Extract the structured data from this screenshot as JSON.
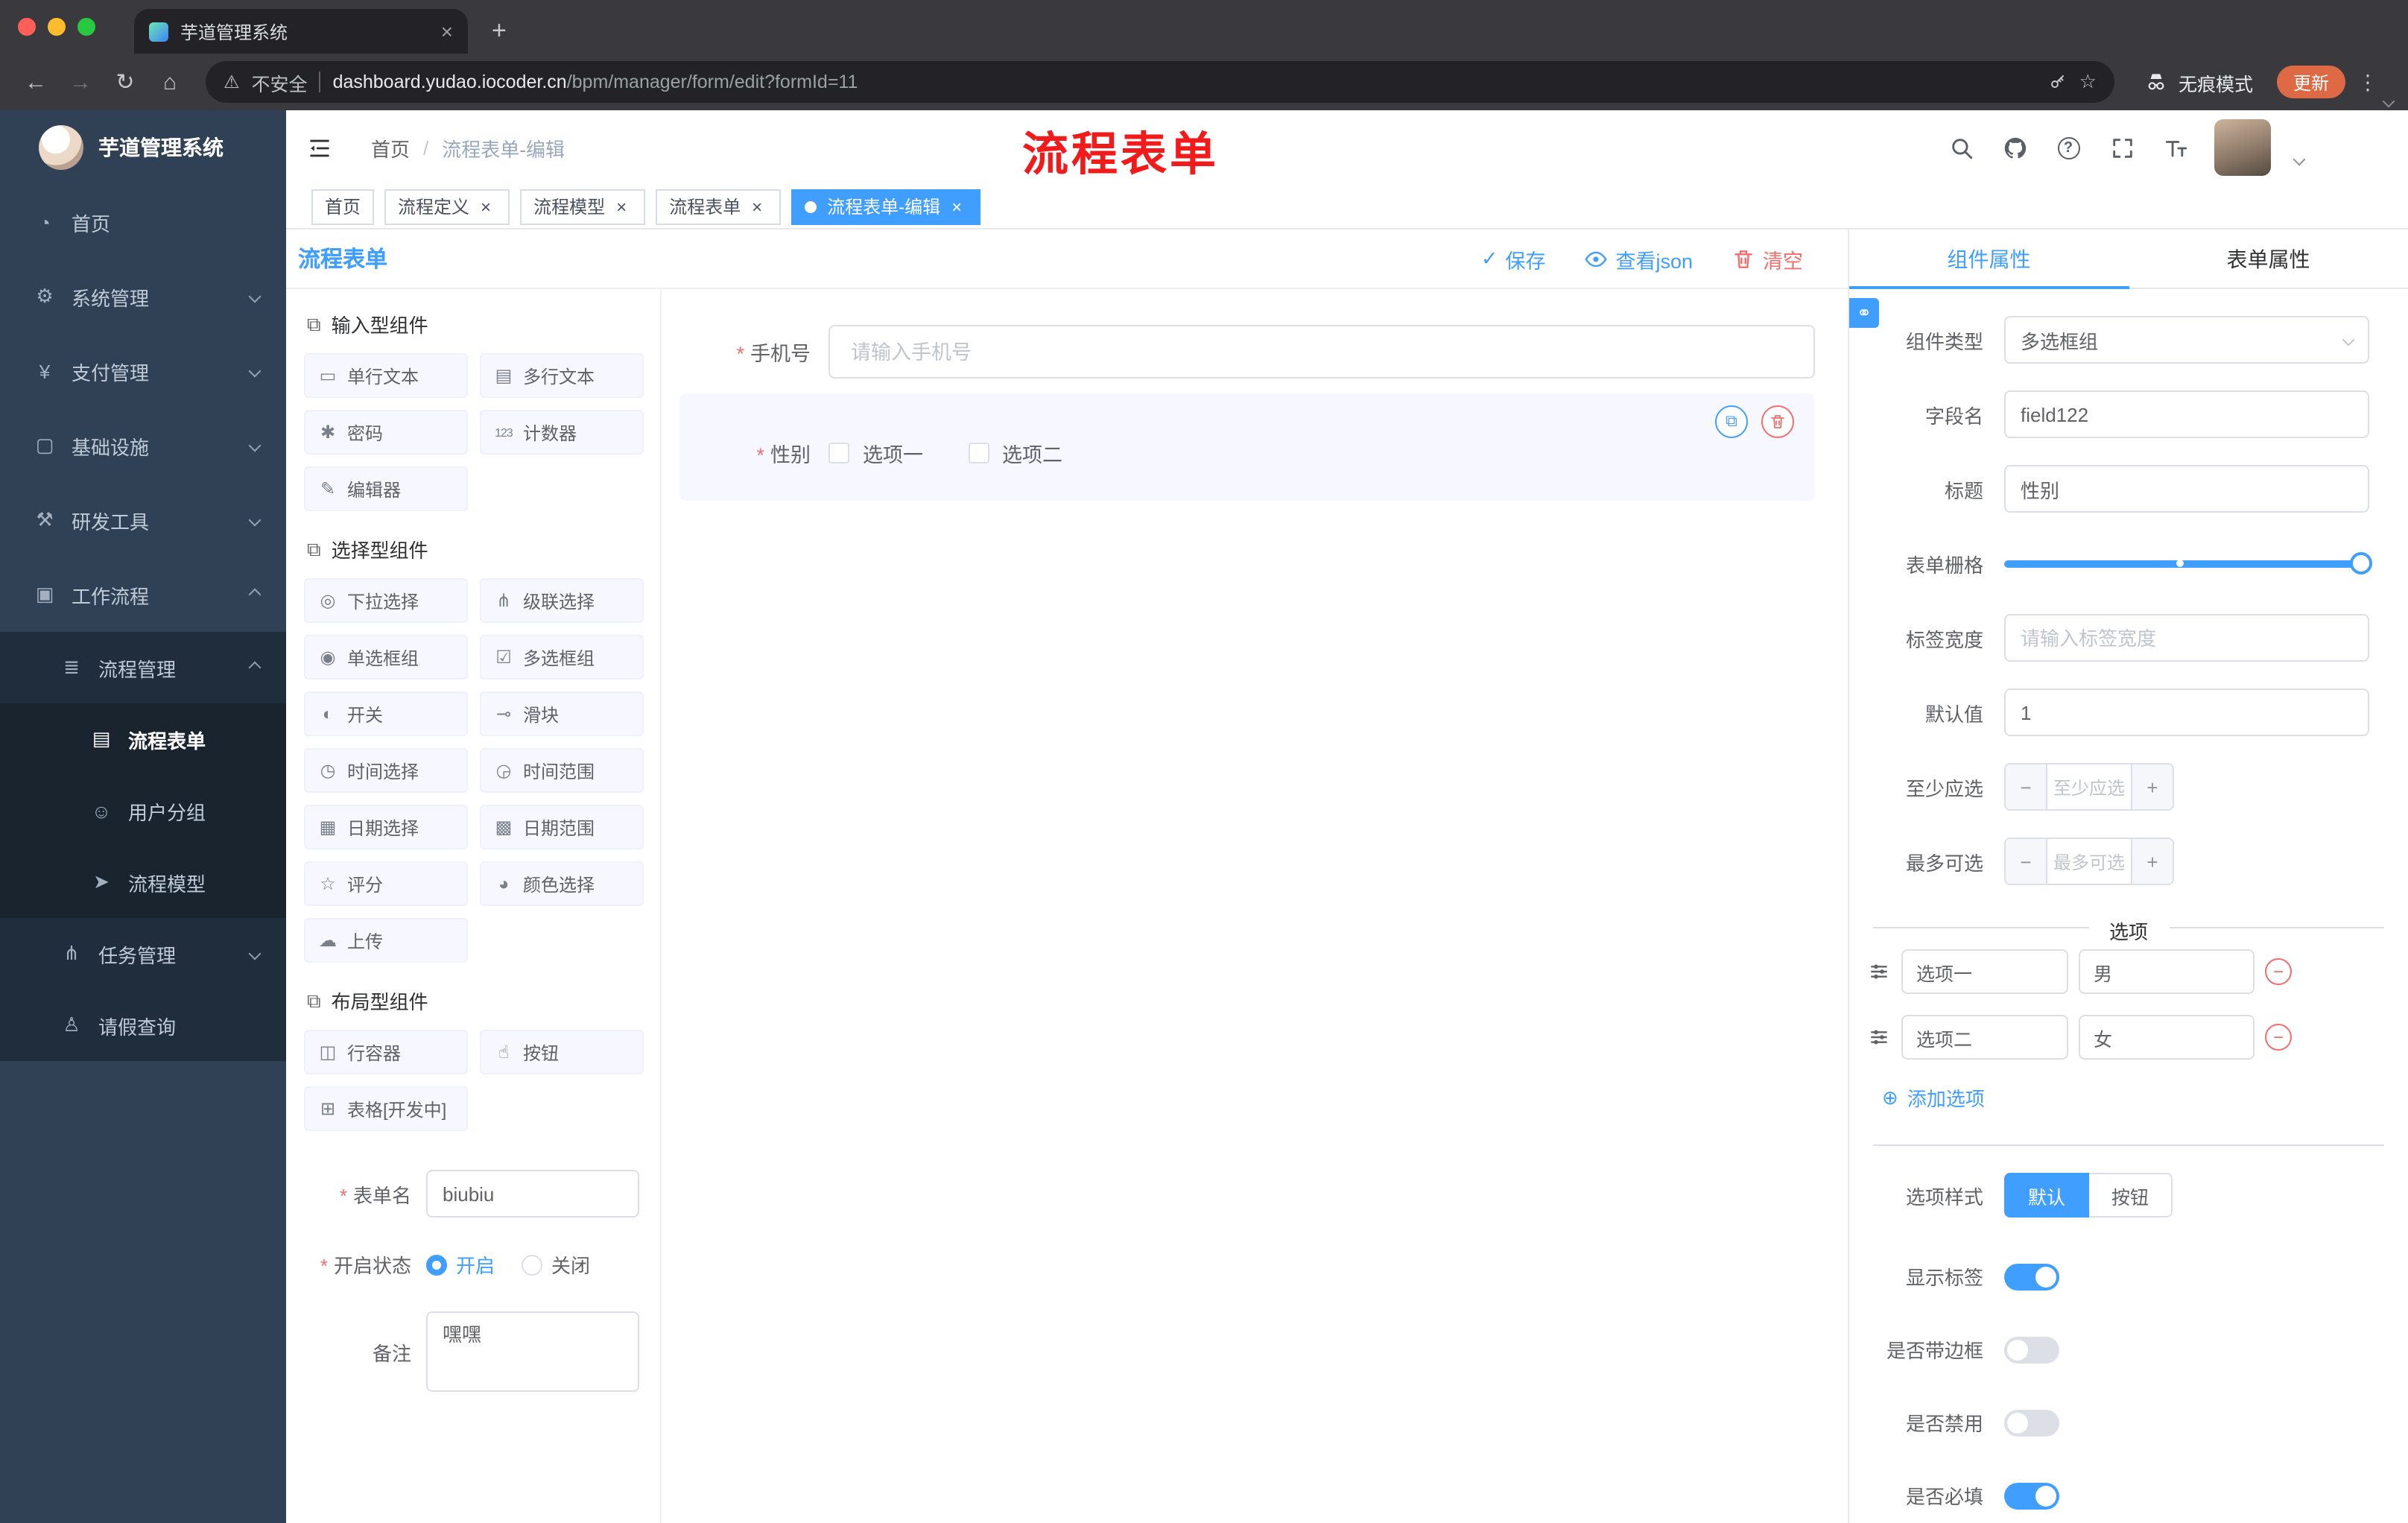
{
  "colors": {
    "primary": "#409eff",
    "danger": "#f56c6c",
    "annotation_red": "#f21b1b",
    "sidebar_bg": "#304156",
    "sidebar_submenu_bg": "#1f2d3d",
    "active_tag_bg": "#409eff"
  },
  "glyphs": {
    "close": "×",
    "plus": "+",
    "kebab": "⋮",
    "minus": "−",
    "check": "✓",
    "circle_plus": "⊕",
    "copy": "⧉",
    "link": "⚭",
    "warning": "⚠",
    "star": "☆",
    "back": "←",
    "forward": "→",
    "reload": "↻",
    "home": "⌂",
    "help": "?"
  },
  "browser": {
    "tab": {
      "title": "芋道管理系统"
    },
    "toolbar": {
      "security_label": "不安全",
      "url_host": "dashboard.yudao.iocoder.cn",
      "url_path": "/bpm/manager/form/edit?formId=11",
      "incognito_label": "无痕模式",
      "update_label": "更新"
    }
  },
  "navbar": {
    "breadcrumb": {
      "home": "首页",
      "separator": "/",
      "current": "流程表单-编辑"
    },
    "annotation": "流程表单"
  },
  "tags": [
    {
      "label": "首页"
    },
    {
      "label": "流程定义"
    },
    {
      "label": "流程模型"
    },
    {
      "label": "流程表单"
    },
    {
      "label": "流程表单-编辑"
    }
  ],
  "sidebar": {
    "logo_title": "芋道管理系统",
    "items": [
      {
        "label": "首页",
        "glyph": "◔"
      },
      {
        "label": "系统管理",
        "glyph": "⚙"
      },
      {
        "label": "支付管理",
        "glyph": "¥"
      },
      {
        "label": "基础设施",
        "glyph": "▢"
      },
      {
        "label": "研发工具",
        "glyph": "⚒"
      },
      {
        "label": "工作流程",
        "glyph": "▣"
      },
      {
        "label": "流程管理",
        "glyph": "≣"
      },
      {
        "label": "流程表单",
        "glyph": "▤"
      },
      {
        "label": "用户分组",
        "glyph": "☺"
      },
      {
        "label": "流程模型",
        "glyph": "➤"
      },
      {
        "label": "任务管理",
        "glyph": "⋔"
      },
      {
        "label": "请假查询",
        "glyph": "♙"
      }
    ]
  },
  "designer": {
    "title": "流程表单",
    "actions": {
      "save": "保存",
      "view_json": "查看json",
      "clear": "清空"
    },
    "groups": [
      {
        "title": "输入型组件",
        "items": [
          {
            "label": "单行文本",
            "glyph": "▭"
          },
          {
            "label": "多行文本",
            "glyph": "▤"
          },
          {
            "label": "密码",
            "glyph": "✱"
          },
          {
            "label": "计数器",
            "glyph": "123"
          },
          {
            "label": "编辑器",
            "glyph": "✎"
          }
        ]
      },
      {
        "title": "选择型组件",
        "items": [
          {
            "label": "下拉选择",
            "glyph": "◎"
          },
          {
            "label": "级联选择",
            "glyph": "⋔"
          },
          {
            "label": "单选框组",
            "glyph": "◉"
          },
          {
            "label": "多选框组",
            "glyph": "☑"
          },
          {
            "label": "开关",
            "glyph": "◐"
          },
          {
            "label": "滑块",
            "glyph": "⊸"
          },
          {
            "label": "时间选择",
            "glyph": "◷"
          },
          {
            "label": "时间范围",
            "glyph": "◶"
          },
          {
            "label": "日期选择",
            "glyph": "▦"
          },
          {
            "label": "日期范围",
            "glyph": "▩"
          },
          {
            "label": "评分",
            "glyph": "☆"
          },
          {
            "label": "颜色选择",
            "glyph": "◕"
          },
          {
            "label": "上传",
            "glyph": "☁"
          }
        ]
      },
      {
        "title": "布局型组件",
        "items": [
          {
            "label": "行容器",
            "glyph": "◫"
          },
          {
            "label": "按钮",
            "glyph": "☝"
          },
          {
            "label": "表格[开发中]",
            "glyph": "⊞"
          }
        ]
      }
    ],
    "meta": {
      "name_label": "表单名",
      "name_value": "biubiu",
      "status_label": "开启状态",
      "status_on": "开启",
      "status_off": "关闭",
      "remark_label": "备注",
      "remark_value": "嘿嘿"
    },
    "canvas": {
      "phone_label": "手机号",
      "phone_placeholder": "请输入手机号",
      "gender_label": "性别",
      "gender_options": [
        {
          "label": "选项一"
        },
        {
          "label": "选项二"
        }
      ]
    }
  },
  "properties": {
    "tab_component": "组件属性",
    "tab_form": "表单属性",
    "component_type_label": "组件类型",
    "component_type_value": "多选框组",
    "field_name_label": "字段名",
    "field_name_value": "field122",
    "title_label": "标题",
    "title_value": "性别",
    "grid_label": "表单栅格",
    "label_width_label": "标签宽度",
    "label_width_placeholder": "请输入标签宽度",
    "default_label": "默认值",
    "default_value": "1",
    "min_label": "至少应选",
    "min_placeholder": "至少应选",
    "max_label": "最多可选",
    "max_placeholder": "最多可选",
    "options_title": "选项",
    "options": [
      {
        "label": "选项一",
        "value": "男"
      },
      {
        "label": "选项二",
        "value": "女"
      }
    ],
    "add_option_label": "添加选项",
    "option_style_label": "选项样式",
    "option_style_default": "默认",
    "option_style_button": "按钮",
    "switches": [
      {
        "label": "显示标签",
        "on": true
      },
      {
        "label": "是否带边框",
        "on": false
      },
      {
        "label": "是否禁用",
        "on": false
      },
      {
        "label": "是否必填",
        "on": true
      }
    ]
  }
}
